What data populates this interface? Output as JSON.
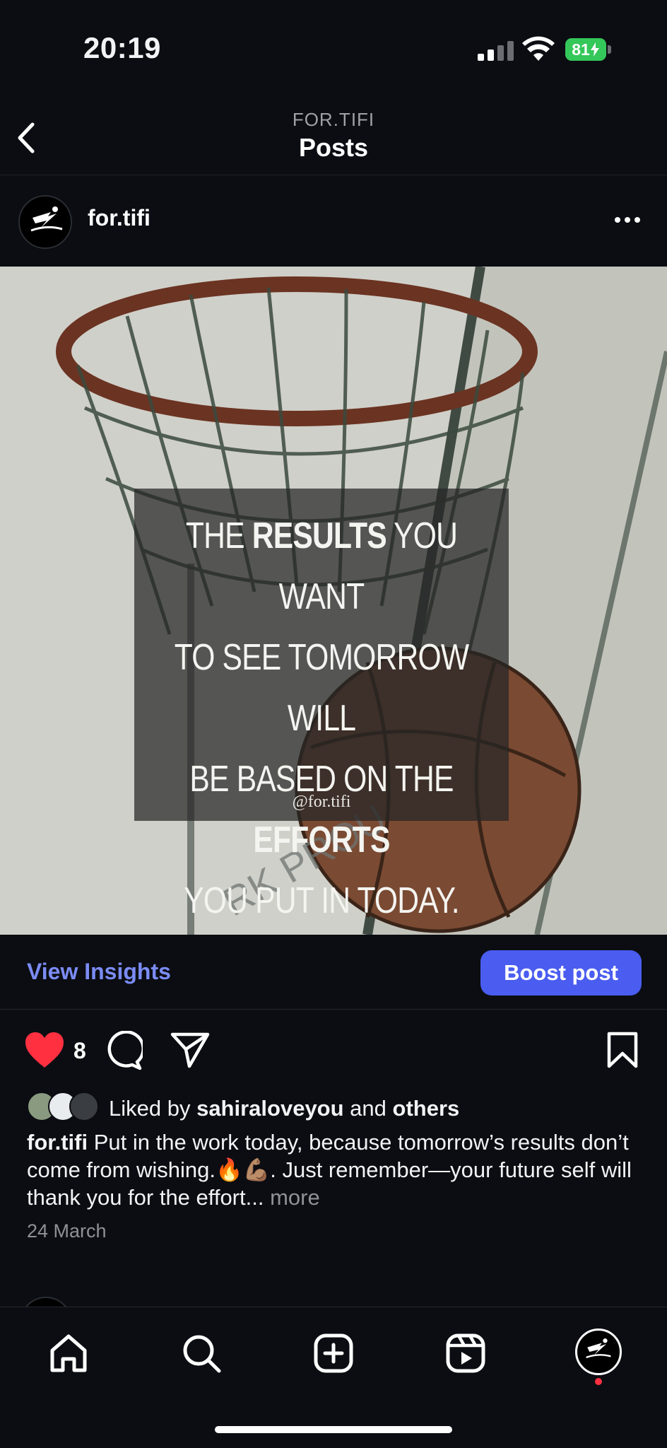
{
  "status_bar": {
    "time": "20:19",
    "battery": "81"
  },
  "nav": {
    "subtitle": "FOR.TIFI",
    "title": "Posts"
  },
  "post": {
    "username": "for.tifi",
    "image_quote": {
      "line1_pre": "THE ",
      "line1_bold": "RESULTS",
      "line1_post": " YOU WANT",
      "line2": "TO SEE TOMORROW WILL",
      "line3": "BE BASED ON THE",
      "line4_bold": "EFFORTS",
      "line5": "YOU PUT IN TODAY.",
      "handle": "@for.tifi"
    },
    "view_insights": "View Insights",
    "boost_label": "Boost post",
    "like_count": "8",
    "liked_by_prefix": "Liked by ",
    "liked_by_user": "sahiraloveyou",
    "liked_by_mid": " and ",
    "liked_by_others": "others",
    "caption_user": "for.tifi",
    "caption_text": " Put in the work today, because tomorrow’s results don’t come from wishing.🔥💪🏽. Just remember—your future self will thank you for the effort...",
    "caption_more": " more",
    "date": "24 March"
  },
  "icons": {
    "back": "chevron-left-icon",
    "like": "heart-icon",
    "comment": "comment-icon",
    "share": "paper-plane-icon",
    "save": "bookmark-icon",
    "home": "home-icon",
    "search": "search-icon",
    "create": "plus-square-icon",
    "reels": "reels-icon"
  },
  "colors": {
    "background": "#0b0d12",
    "accent": "#4a5df0",
    "insights": "#7b8cf5",
    "like": "#ff3040",
    "battery": "#34c759"
  }
}
